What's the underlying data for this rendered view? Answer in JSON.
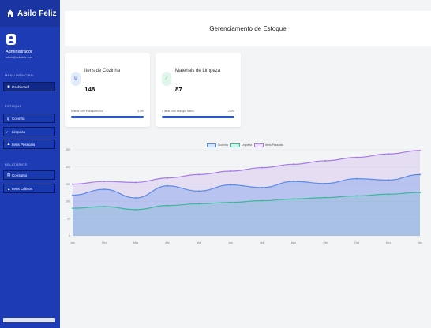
{
  "brand": {
    "title": "Asilo Feliz",
    "icon": "home-icon"
  },
  "user": {
    "name": "Administrador",
    "email": "admin@asilofeliz.com"
  },
  "sidebar": {
    "sections": [
      {
        "label": "MENU PRINCIPAL"
      },
      {
        "label": "ESTOQUE"
      },
      {
        "label": "RELATÓRIOS"
      }
    ],
    "items": [
      {
        "label": "Dashboard",
        "icon": "dashboard-icon"
      },
      {
        "label": "Cozinha",
        "icon": "utensils-icon"
      },
      {
        "label": "Limpeza",
        "icon": "broom-icon"
      },
      {
        "label": "Itens Pessoais",
        "icon": "user-icon"
      },
      {
        "label": "Consumo",
        "icon": "chart-icon"
      },
      {
        "label": "Itens Críticos",
        "icon": "warning-icon"
      }
    ]
  },
  "header": {
    "title": "Gerenciamento de Estoque"
  },
  "cards": [
    {
      "title": "Itens de Cozinha",
      "value": "148",
      "low_stock": "5 itens com estoque baixo",
      "percent": "3.4%",
      "icon": "utensils-icon",
      "accent": "#3b6fe0"
    },
    {
      "title": "Materiais de Limpeza",
      "value": "87",
      "low_stock": "2 itens com estoque baixo",
      "percent": "2.3%",
      "icon": "broom-icon",
      "accent": "#2fbf71"
    }
  ],
  "colors": {
    "sidebar": "#1d3bb5",
    "blue": "#5b8be8",
    "green": "#3cb89a",
    "purple": "#a67ae8"
  },
  "chart_data": {
    "type": "area",
    "categories": [
      "Jan",
      "Fev",
      "Mar",
      "Abr",
      "Mai",
      "Jun",
      "Jul",
      "Ago",
      "Set",
      "Out",
      "Nov",
      "Dez"
    ],
    "series": [
      {
        "name": "Cozinha",
        "values": [
          118,
          135,
          110,
          145,
          130,
          148,
          140,
          158,
          152,
          166,
          162,
          178
        ]
      },
      {
        "name": "Limpeza",
        "values": [
          80,
          85,
          76,
          88,
          93,
          97,
          102,
          107,
          111,
          116,
          121,
          126
        ]
      },
      {
        "name": "Itens Pessoais",
        "values": [
          150,
          158,
          155,
          168,
          178,
          188,
          198,
          208,
          218,
          228,
          238,
          248
        ]
      }
    ],
    "ylim": [
      0,
      250
    ],
    "yticks": [
      0,
      50,
      100,
      150,
      200,
      250
    ],
    "grid": true,
    "legend": "top"
  }
}
